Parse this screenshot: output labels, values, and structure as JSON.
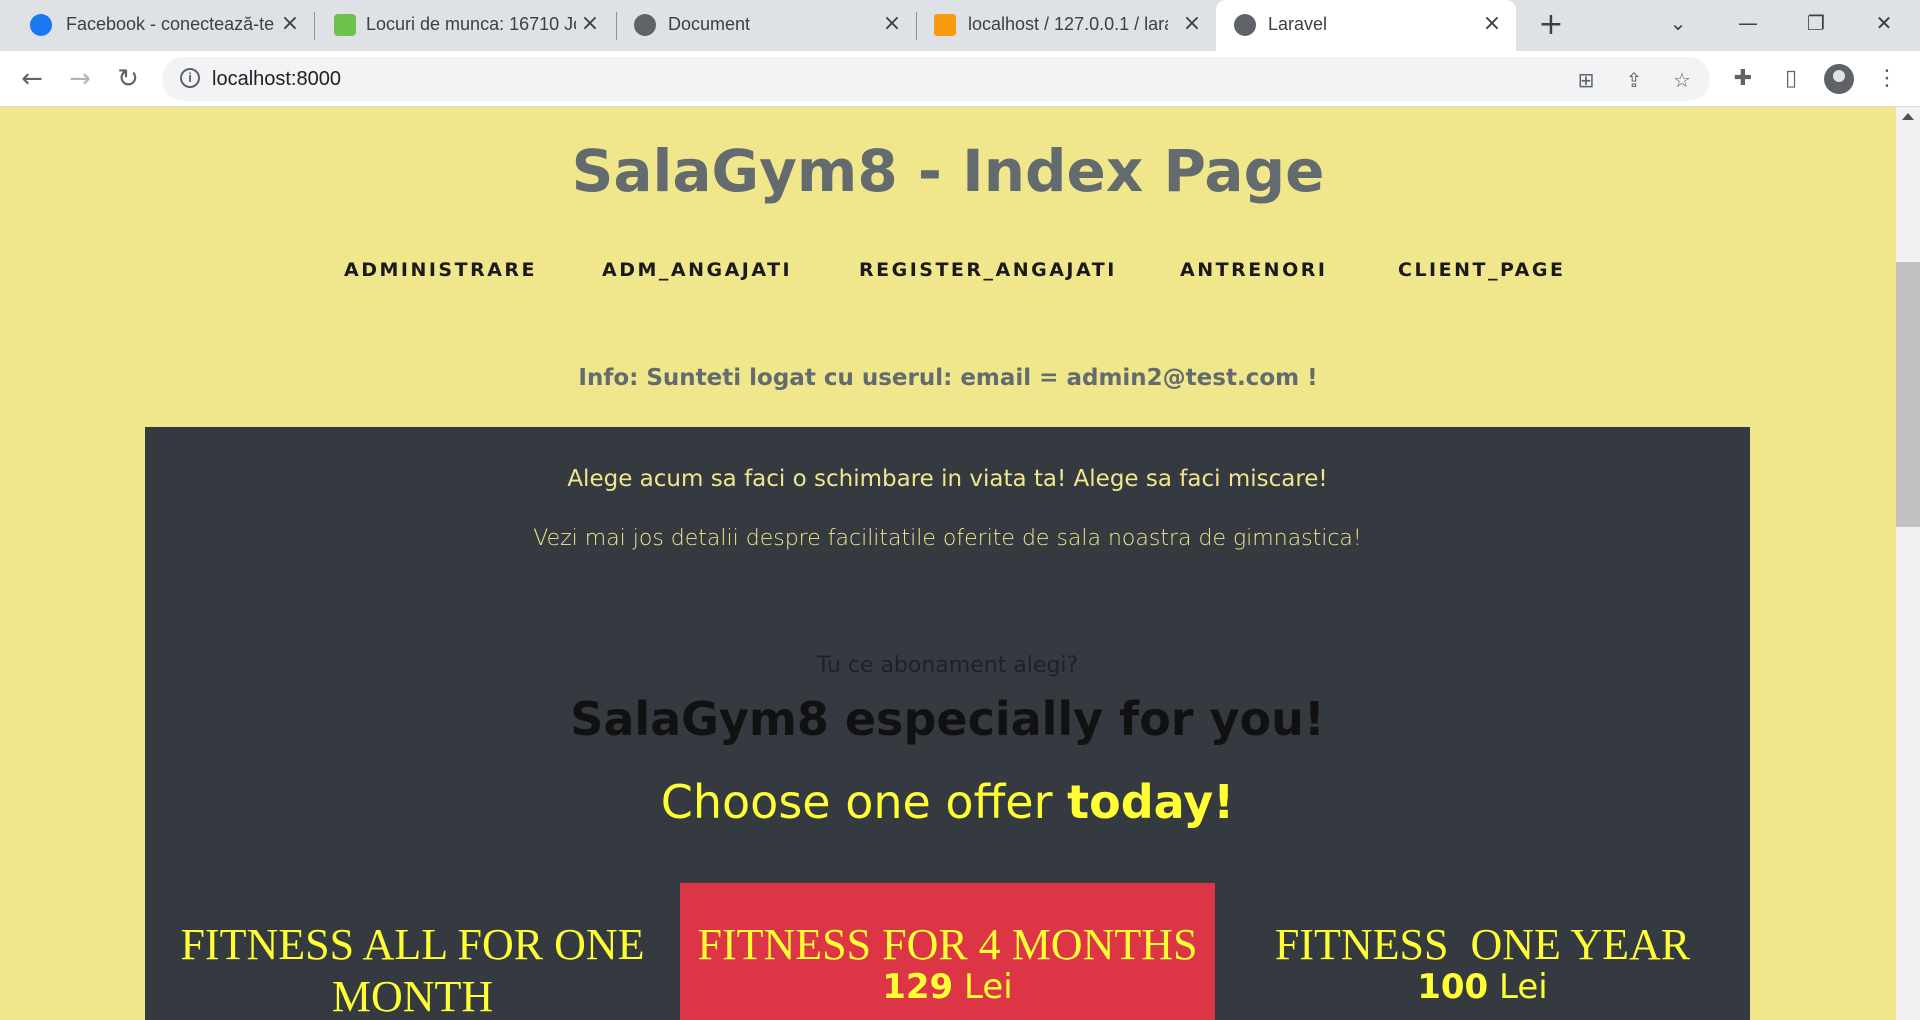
{
  "browser": {
    "tabs": [
      {
        "title": "Facebook - conectează-te",
        "icon": "facebook-icon"
      },
      {
        "title": "Locuri de munca: 16710 Jobs",
        "icon": "bestjobs-icon"
      },
      {
        "title": "Document",
        "icon": "globe-icon"
      },
      {
        "title": "localhost / 127.0.0.1 / laravel",
        "icon": "phpmyadmin-icon"
      },
      {
        "title": "Laravel",
        "icon": "globe-icon",
        "active": true
      }
    ],
    "url": "localhost:8000"
  },
  "page": {
    "title": "SalaGym8 - Index Page",
    "nav": [
      "ADMINISTRARE",
      "ADM_ANGAJATI",
      "REGISTER_ANGAJATI",
      "ANTRENORI",
      "CLIENT_PAGE"
    ],
    "info": "Info: Sunteti logat cu userul: email = admin2@test.com !",
    "promo_line1": "Alege acum sa faci o schimbare in viata ta! Alege sa faci miscare!",
    "promo_line2": "Vezi mai jos detalii despre facilitatile oferite de sala noastra de gimnastica!",
    "subheading": "Tu ce abonament alegi?",
    "heading": "SalaGym8 especially for you!",
    "offer_prefix": "Choose one offer",
    "offer_emphasis": "today!",
    "offers": [
      {
        "title": "FITNESS ALL FOR ONE MONTH",
        "price": "",
        "currency": ""
      },
      {
        "title": "FITNESS FOR 4 MONTHS",
        "price": "129",
        "currency": "Lei"
      },
      {
        "title": "FITNESS  ONE YEAR",
        "price": "100",
        "currency": "Lei"
      }
    ]
  },
  "colors": {
    "page_bg": "#f0e68c",
    "dark_panel": "#343a40",
    "featured_card": "#dc3545",
    "accent_yellow": "#ffff33"
  }
}
